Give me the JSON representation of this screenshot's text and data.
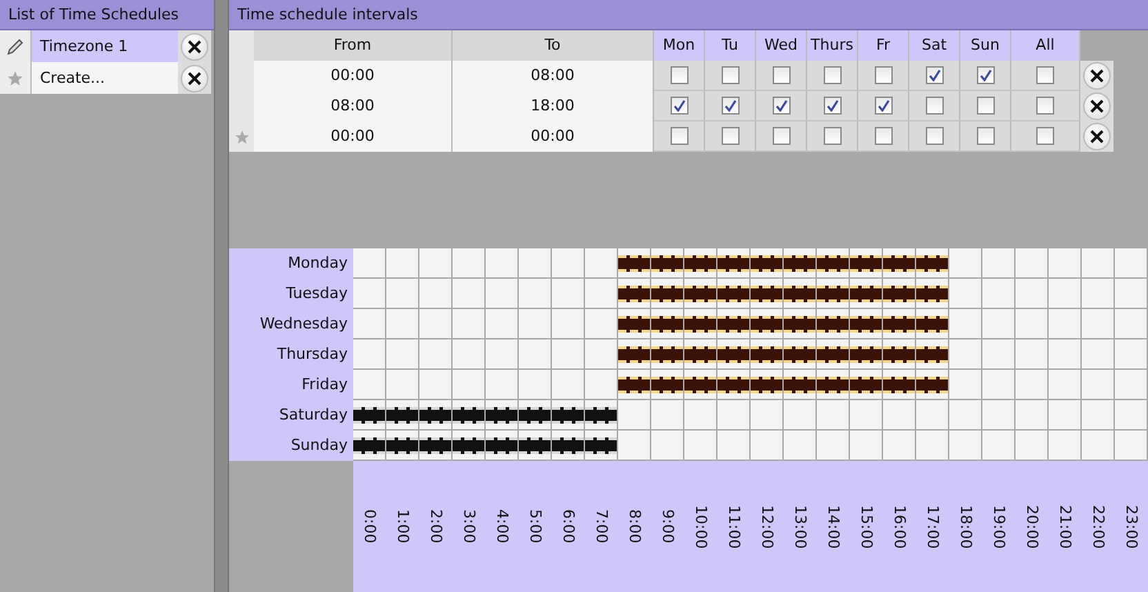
{
  "schedules_panel": {
    "title": "List of Time Schedules",
    "items": [
      {
        "name": "Timezone 1",
        "kind": "existing",
        "selected": true
      },
      {
        "name": "Create...",
        "kind": "new",
        "selected": false
      }
    ]
  },
  "intervals_panel": {
    "title": "Time schedule intervals",
    "columns": [
      "From",
      "To",
      "Mon",
      "Tu",
      "Wed",
      "Thurs",
      "Fr",
      "Sat",
      "Sun",
      "All"
    ],
    "rows": [
      {
        "from": "00:00",
        "to": "08:00",
        "kind": "existing",
        "color": "#111111",
        "days": [
          {
            "checked": false
          },
          {
            "checked": false
          },
          {
            "checked": false
          },
          {
            "checked": false
          },
          {
            "checked": false
          },
          {
            "checked": true
          },
          {
            "checked": true
          }
        ],
        "all": {
          "checked": false
        }
      },
      {
        "from": "08:00",
        "to": "18:00",
        "kind": "existing",
        "color": "#3a1206",
        "days": [
          {
            "checked": true
          },
          {
            "checked": true
          },
          {
            "checked": true
          },
          {
            "checked": true
          },
          {
            "checked": true
          },
          {
            "checked": false
          },
          {
            "checked": false
          }
        ],
        "all": {
          "checked": false
        }
      },
      {
        "from": "00:00",
        "to": "00:00",
        "kind": "new",
        "days": [
          {
            "checked": false
          },
          {
            "checked": false
          },
          {
            "checked": false
          },
          {
            "checked": false
          },
          {
            "checked": false
          },
          {
            "checked": false
          },
          {
            "checked": false
          }
        ],
        "all": {
          "checked": false
        }
      }
    ]
  },
  "week_grid": {
    "days": [
      "Monday",
      "Tuesday",
      "Wednesday",
      "Thursday",
      "Friday",
      "Saturday",
      "Sunday"
    ],
    "hours": [
      "0:00",
      "1:00",
      "2:00",
      "3:00",
      "4:00",
      "5:00",
      "6:00",
      "7:00",
      "8:00",
      "9:00",
      "10:00",
      "11:00",
      "12:00",
      "13:00",
      "14:00",
      "15:00",
      "16:00",
      "17:00",
      "18:00",
      "19:00",
      "20:00",
      "21:00",
      "22:00",
      "23:00"
    ]
  }
}
